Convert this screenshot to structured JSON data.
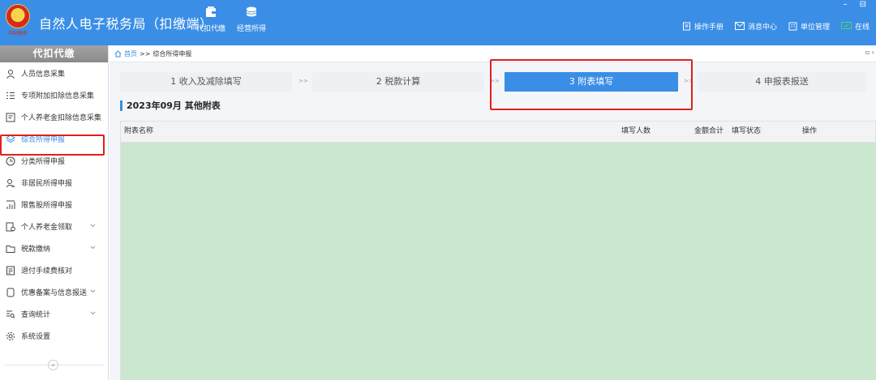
{
  "header": {
    "title": "自然人电子税务局（扣缴端）",
    "logo_signature": "中国税务",
    "nav": [
      {
        "label": "代扣代缴",
        "icon": "wallet-icon"
      },
      {
        "label": "经营所得",
        "icon": "coins-icon"
      }
    ],
    "toolbar": [
      {
        "label": "操作手册",
        "icon": "manual-icon"
      },
      {
        "label": "消息中心",
        "icon": "mail-icon"
      },
      {
        "label": "单位管理",
        "icon": "building-icon"
      }
    ],
    "status": "在线",
    "window_controls": "– ⊟"
  },
  "sidebar": {
    "heading": "代扣代缴",
    "items": [
      {
        "label": "人员信息采集",
        "icon": "person-icon"
      },
      {
        "label": "专项附加扣除信息采集",
        "icon": "list-icon"
      },
      {
        "label": "个人养老金扣除信息采集",
        "icon": "card-icon"
      },
      {
        "label": "综合所得申报",
        "icon": "layers-icon",
        "active": true
      },
      {
        "label": "分类所得申报",
        "icon": "clock-icon"
      },
      {
        "label": "非居民所得申报",
        "icon": "user-outline-icon"
      },
      {
        "label": "限售股所得申报",
        "icon": "bar-chart-icon"
      },
      {
        "label": "个人养老金领取",
        "icon": "pension-icon",
        "expandable": true
      },
      {
        "label": "税款缴纳",
        "icon": "folder-icon",
        "expandable": true
      },
      {
        "label": "退付手续费核对",
        "icon": "receipt-icon"
      },
      {
        "label": "优惠备案与信息报送",
        "icon": "document-icon",
        "expandable": true
      },
      {
        "label": "查询统计",
        "icon": "search-list-icon",
        "expandable": true
      },
      {
        "label": "系统设置",
        "icon": "gear-icon"
      }
    ],
    "collapse_label": "«"
  },
  "breadcrumb": {
    "home": "首页",
    "separator": ">>",
    "current": "综合所得申报",
    "corner": "▫ ›"
  },
  "steps": [
    {
      "label": "1 收入及减除填写"
    },
    {
      "label": "2 税款计算"
    },
    {
      "label": "3 附表填写",
      "active": true
    },
    {
      "label": "4 申报表报送"
    }
  ],
  "step_separator": ">>",
  "section_title": "2023年09月 其他附表",
  "table": {
    "columns": [
      "附表名称",
      "填写人数",
      "金额合计",
      "填写状态",
      "操作"
    ],
    "rows": []
  },
  "colors": {
    "header_bg": "#3a8ee6",
    "active_blue": "#3a8ee6",
    "table_body_bg": "#cbe7cf",
    "highlight_red": "#e0201b",
    "online_green": "#4cd964"
  }
}
